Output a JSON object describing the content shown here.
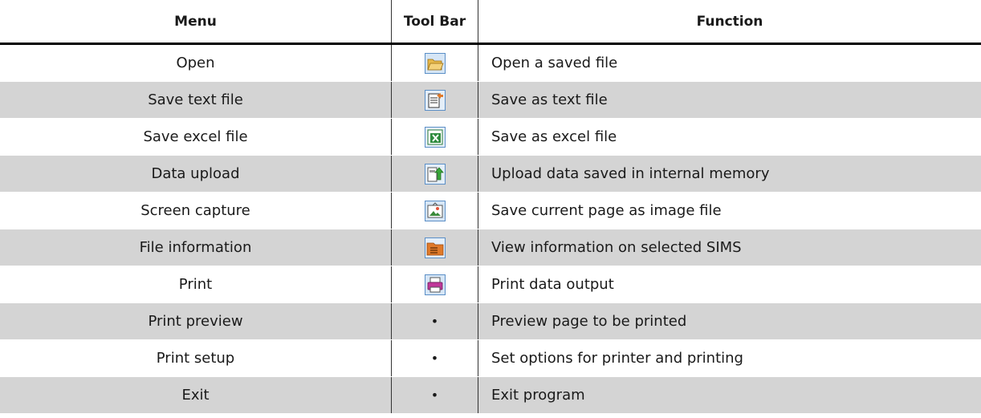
{
  "header": {
    "menu": "Menu",
    "toolbar": "Tool Bar",
    "function": "Function"
  },
  "rows": [
    {
      "menu": "Open",
      "icon": "folder-open-icon",
      "function": "Open a saved file",
      "shaded": false
    },
    {
      "menu": "Save text file",
      "icon": "save-text-icon",
      "function": "Save as text file",
      "shaded": true
    },
    {
      "menu": "Save excel file",
      "icon": "excel-icon",
      "function": "Save as excel file",
      "shaded": false
    },
    {
      "menu": "Data upload",
      "icon": "upload-icon",
      "function": "Upload data saved in internal memory",
      "shaded": true
    },
    {
      "menu": "Screen capture",
      "icon": "capture-icon",
      "function": "Save current page as image file",
      "shaded": false
    },
    {
      "menu": "File information",
      "icon": "file-info-icon",
      "function": "View information on selected SIMS",
      "shaded": true
    },
    {
      "menu": "Print",
      "icon": "printer-icon",
      "function": "Print data output",
      "shaded": false
    },
    {
      "menu": "Print preview",
      "icon": "bullet",
      "bullet": "•",
      "function": "Preview page to be printed",
      "shaded": true
    },
    {
      "menu": "Print setup",
      "icon": "bullet",
      "bullet": "•",
      "function": "Set options for printer and printing",
      "shaded": false
    },
    {
      "menu": "Exit",
      "icon": "bullet",
      "bullet": "•",
      "function": "Exit program",
      "shaded": true
    }
  ]
}
